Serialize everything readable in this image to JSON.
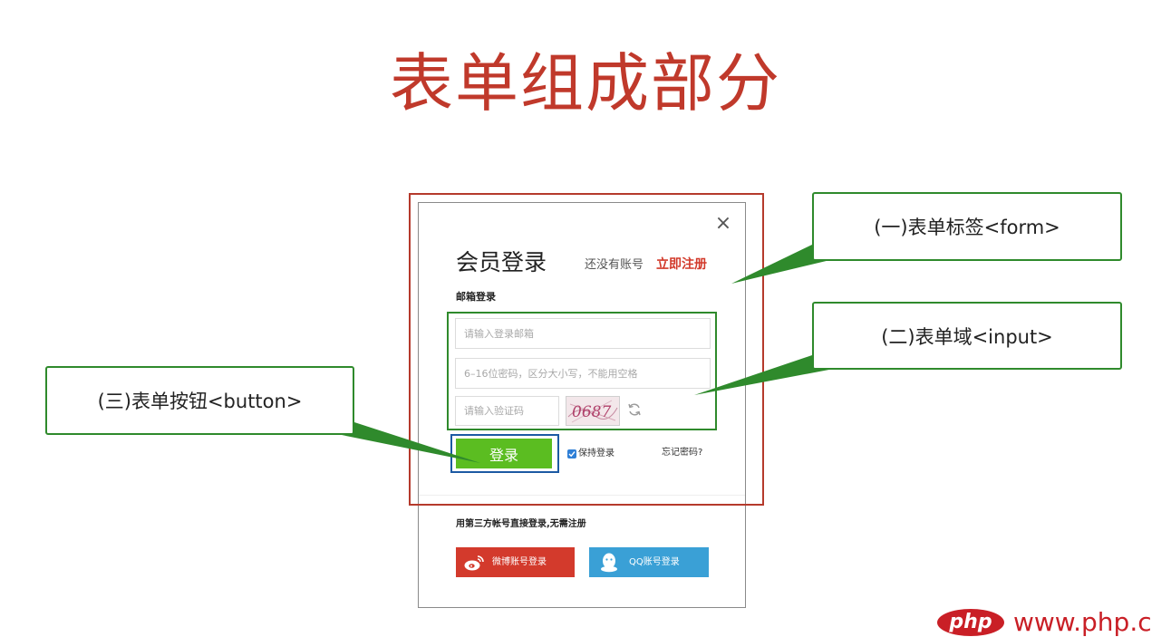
{
  "slide": {
    "title": "表单组成部分"
  },
  "dialog": {
    "close_symbol": "×",
    "title": "会员登录",
    "no_account_text": "还没有账号",
    "register_link": "立即注册",
    "email_login_label": "邮箱登录",
    "email_placeholder": "请输入登录邮箱",
    "password_placeholder": "6–16位密码，区分大小写，不能用空格",
    "captcha_placeholder": "请输入验证码",
    "captcha_text": "0687",
    "login_button": "登录",
    "remember_label": "保持登录",
    "remember_checked": true,
    "forgot_link": "忘记密码?",
    "third_party_label": "用第三方帐号直接登录,无需注册",
    "weibo_button": "微博账号登录",
    "qq_button": "QQ账号登录"
  },
  "callouts": {
    "form": "(一)表单标签<form>",
    "input": "(二)表单域<input>",
    "button": "(三)表单按钮<button>"
  },
  "watermark": {
    "logo": "php",
    "site": "www.php.c"
  },
  "colors": {
    "title": "#c0392b",
    "register_link": "#d23a2b",
    "login_button": "#5bbd21",
    "weibo": "#d33a2c",
    "qq": "#3aa0d6",
    "form_frame": "#b53a2c",
    "input_frame": "#2f8a2c",
    "button_frame": "#1c5aa3",
    "callout_border": "#2f8a2c"
  }
}
